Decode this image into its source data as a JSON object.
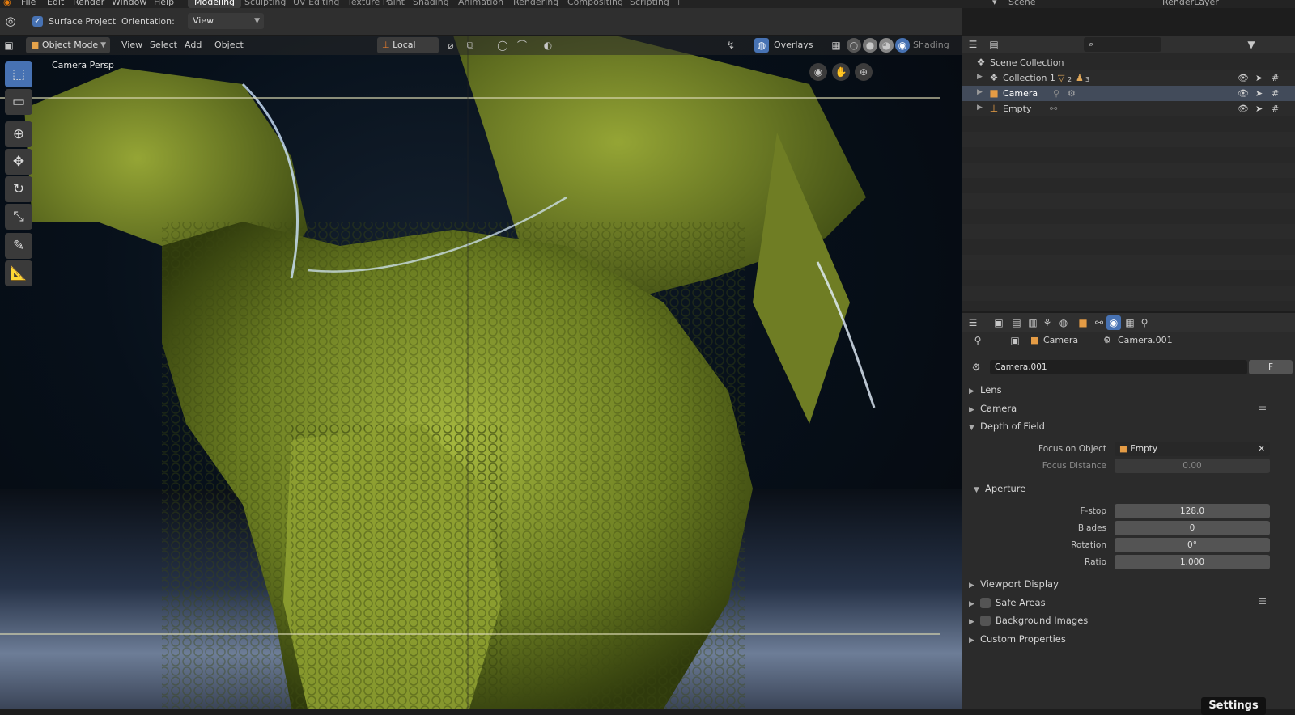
{
  "menu": {
    "file": "File",
    "edit": "Edit",
    "render": "Render",
    "window": "Window",
    "help": "Help"
  },
  "workspaces": [
    "Modeling",
    "Sculpting",
    "UV Editing",
    "Texture Paint",
    "Shading",
    "Animation",
    "Rendering",
    "Compositing",
    "Scripting"
  ],
  "topright": {
    "scene": "Scene",
    "view_layer": "RenderLayer"
  },
  "tool_header": {
    "surface_project": "Surface Project",
    "orientation_label": "Orientation:",
    "orientation_value": "View"
  },
  "viewport_header": {
    "mode": "Object Mode",
    "view": "View",
    "select": "Select",
    "add": "Add",
    "object": "Object",
    "transform_orientation": "Local",
    "overlays": "Overlays",
    "shading": "Shading"
  },
  "viewport": {
    "overlay_text": "Camera Persp"
  },
  "outliner": {
    "rows": [
      {
        "label": "Scene Collection"
      },
      {
        "label": "Collection 1",
        "count_a": "2",
        "count_b": "3"
      },
      {
        "label": "Camera"
      },
      {
        "label": "Empty"
      }
    ]
  },
  "properties": {
    "breadcrumb_object": "Camera",
    "breadcrumb_data": "Camera.001",
    "datablock_name": "Camera.001",
    "fake_user": "F",
    "sections": {
      "lens": "Lens",
      "camera": "Camera",
      "dof": "Depth of Field",
      "aperture": "Aperture",
      "viewport_display": "Viewport Display",
      "safe_areas": "Safe Areas",
      "background_images": "Background Images",
      "custom_properties": "Custom Properties"
    },
    "dof": {
      "focus_object_label": "Focus on Object",
      "focus_object_value": "Empty",
      "focus_distance_label": "Focus Distance",
      "focus_distance_value": "0.00"
    },
    "aperture": {
      "fstop_label": "F-stop",
      "fstop_value": "128.0",
      "blades_label": "Blades",
      "blades_value": "0",
      "rotation_label": "Rotation",
      "rotation_value": "0°",
      "ratio_label": "Ratio",
      "ratio_value": "1.000"
    }
  },
  "overlay_button": "Settings",
  "colors": {
    "accent": "#4772b3",
    "selected_row": "#424b5a",
    "dragon": "#7a8f2a"
  }
}
